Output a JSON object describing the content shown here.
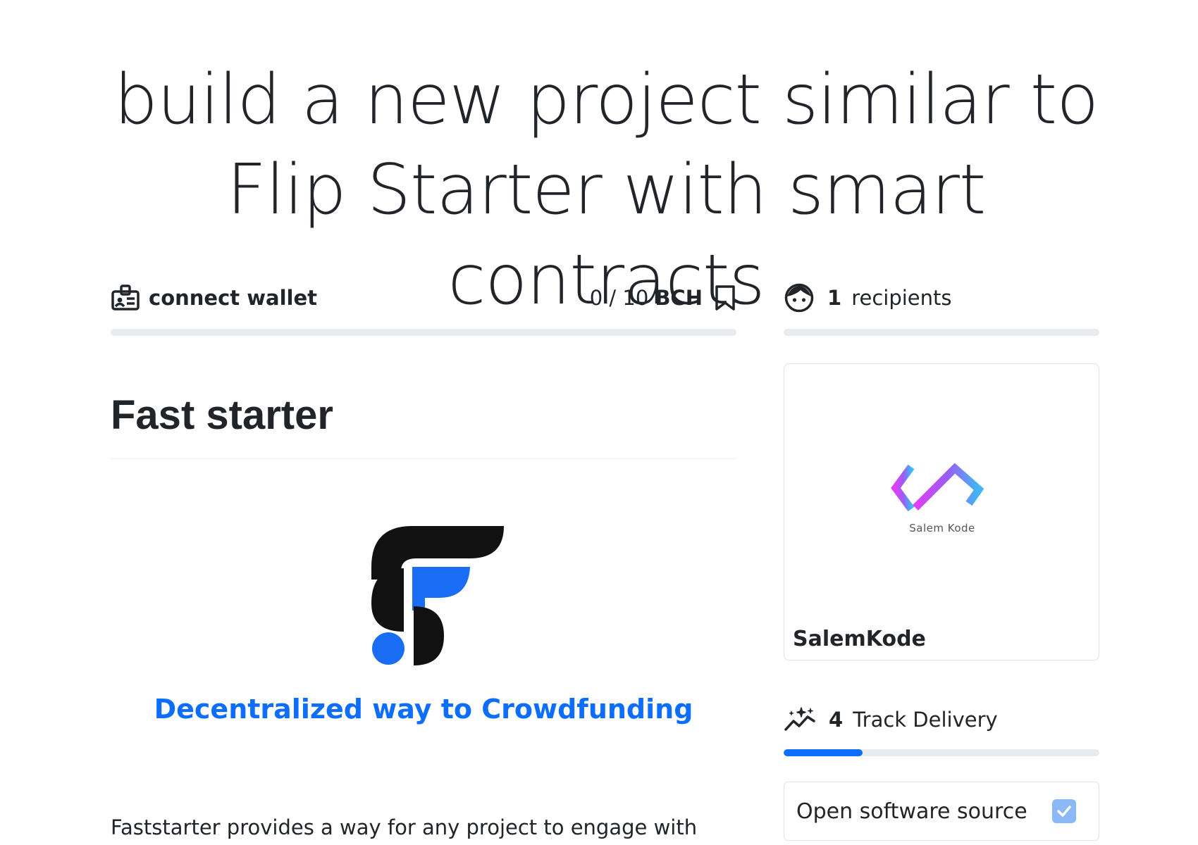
{
  "header": {
    "title_line1": "build a new project similar to",
    "title_line2": "Flip Starter with smart contracts"
  },
  "wallet": {
    "connect_label": "connect wallet",
    "icon": "id-card-icon"
  },
  "funding": {
    "amount_text": "0 / 10",
    "unit": "BCH",
    "raised": 0,
    "goal": 10,
    "progress_fraction": 0,
    "bookmark_icon": "bookmark-icon"
  },
  "recipients": {
    "count": "1",
    "label": "recipients",
    "icon": "face-icon",
    "progress_fraction": 0
  },
  "project": {
    "section_title": "Fast starter",
    "tagline": "Decentralized way to Crowdfunding",
    "description": "Faststarter provides a way for any project to engage with"
  },
  "recipient_card": {
    "logo_text": "Salem Kode",
    "name": "SalemKode"
  },
  "delivery": {
    "count": "4",
    "label": "Track Delivery",
    "icon": "sparkline-stars-icon",
    "progress_fraction": 0.25
  },
  "checklist": {
    "label": "Open software source",
    "checked": true
  },
  "colors": {
    "accent": "#0d6efd",
    "track": "#e9ecef",
    "text": "#212529",
    "checkbox": "#8bb9f8"
  }
}
